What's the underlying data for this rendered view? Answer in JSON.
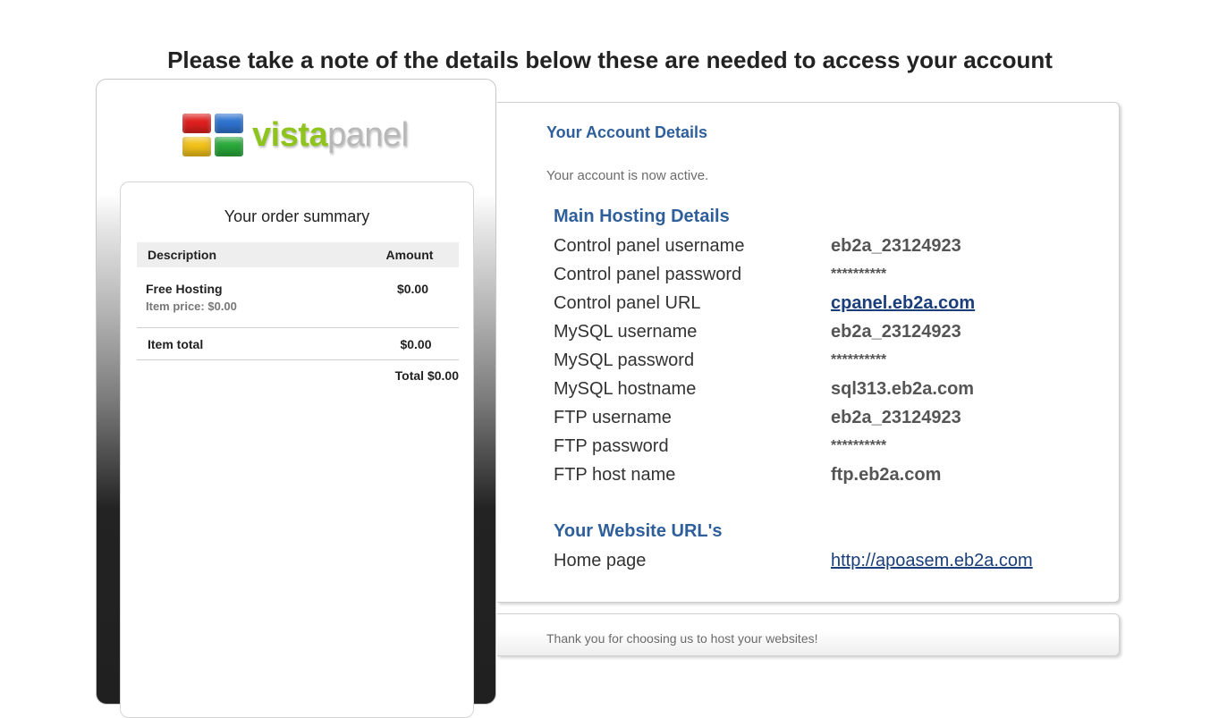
{
  "heading": "Please take a note of the details below these are needed to access your account",
  "logo": {
    "text_part1": "vista",
    "text_part2": "panel",
    "icon": "vistapanel-logo-icon"
  },
  "order_summary": {
    "title": "Your order summary",
    "columns": {
      "description": "Description",
      "amount": "Amount"
    },
    "item": {
      "name": "Free Hosting",
      "price_label": "Item price: $0.00",
      "amount": "$0.00"
    },
    "item_total": {
      "label": "Item total",
      "amount": "$0.00"
    },
    "total": "Total $0.00"
  },
  "account": {
    "title": "Your Account Details",
    "status": "Your account is now active.",
    "main_heading": "Main Hosting Details",
    "details": [
      {
        "label": "Control panel username",
        "value": "eb2a_23124923"
      },
      {
        "label": "Control panel password",
        "value": "**********"
      },
      {
        "label": "Control panel URL",
        "value": "cpanel.eb2a.com"
      },
      {
        "label": "MySQL username",
        "value": "eb2a_23124923"
      },
      {
        "label": "MySQL password",
        "value": "**********"
      },
      {
        "label": "MySQL hostname",
        "value": "sql313.eb2a.com"
      },
      {
        "label": "FTP username",
        "value": "eb2a_23124923"
      },
      {
        "label": "FTP password",
        "value": "**********"
      },
      {
        "label": "FTP host name",
        "value": "ftp.eb2a.com"
      }
    ],
    "website_heading": "Your Website URL's",
    "homepage": {
      "label": "Home page",
      "value": "http://apoasem.eb2a.com"
    }
  },
  "footer": {
    "text": "Thank you for choosing us to host your websites!"
  },
  "colors": {
    "heading_blue": "#2f5f9a",
    "link_blue": "#1a3e7a",
    "logo_green": "#8fc41e"
  }
}
